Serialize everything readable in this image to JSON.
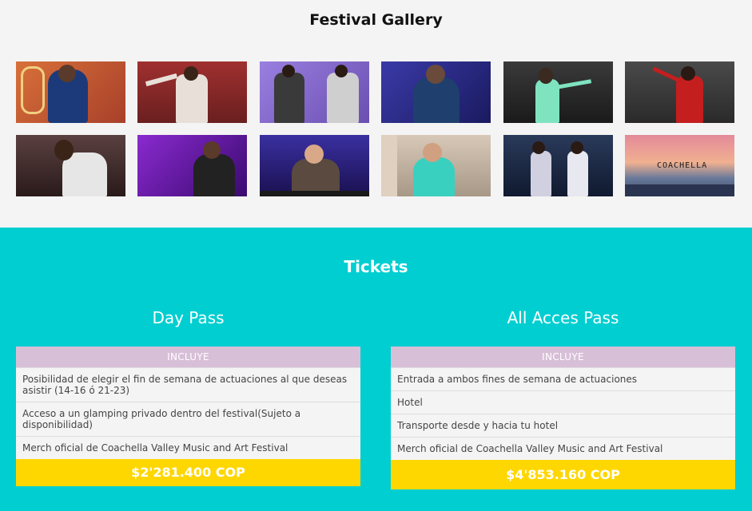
{
  "gallery": {
    "title": "Festival Gallery",
    "photos": [
      {
        "name": "photo-1",
        "bg": "#c0562f",
        "accent": "#1c3a7a"
      },
      {
        "name": "photo-2",
        "bg": "#9c2f2f",
        "accent": "#e8e0d8"
      },
      {
        "name": "photo-3",
        "bg": "#8a6fd1",
        "accent": "#3a3a3a"
      },
      {
        "name": "photo-4",
        "bg": "#2b2b8f",
        "accent": "#1f3f6e"
      },
      {
        "name": "photo-5",
        "bg": "#2a2a2a",
        "accent": "#7fe3c0"
      },
      {
        "name": "photo-6",
        "bg": "#3a3a3a",
        "accent": "#c41e1e"
      },
      {
        "name": "photo-7",
        "bg": "#3a2a2a",
        "accent": "#e6e6e6"
      },
      {
        "name": "photo-8",
        "bg": "#5a1a8f",
        "accent": "#222"
      },
      {
        "name": "photo-9",
        "bg": "#2a2080",
        "accent": "#5a4a40"
      },
      {
        "name": "photo-10",
        "bg": "#c8b8a8",
        "accent": "#39d0c0"
      },
      {
        "name": "photo-11",
        "bg": "#1f2a45",
        "accent": "#d0d0e0"
      },
      {
        "name": "photo-12",
        "bg": "#e07a8a",
        "accent": "#4a5a7a"
      }
    ]
  },
  "tickets": {
    "title": "Tickets",
    "day_pass": {
      "name": "Day Pass",
      "header": "INCLUYE",
      "features": [
        "Posibilidad de elegir el fin de semana de actuaciones al que deseas asistir (14-16 ó 21-23)",
        "Acceso a un glamping privado dentro del festival(Sujeto a disponibilidad)",
        "Merch oficial de Coachella Valley Music and Art Festival"
      ],
      "price": "$2'281.400 COP"
    },
    "all_access": {
      "name": "All Acces Pass",
      "header": "INCLUYE",
      "features": [
        "Entrada a ambos fines de semana de actuaciones",
        "Hotel",
        "Transporte desde y hacia tu hotel",
        "Merch oficial de Coachella Valley Music and Art Festival"
      ],
      "price": "$4'853.160 COP"
    }
  },
  "colors": {
    "tickets_bg": "#00ced1",
    "header_bg": "#d8bfd8",
    "price_bg": "#ffd700"
  },
  "coachella_sign": "COACHELLA"
}
